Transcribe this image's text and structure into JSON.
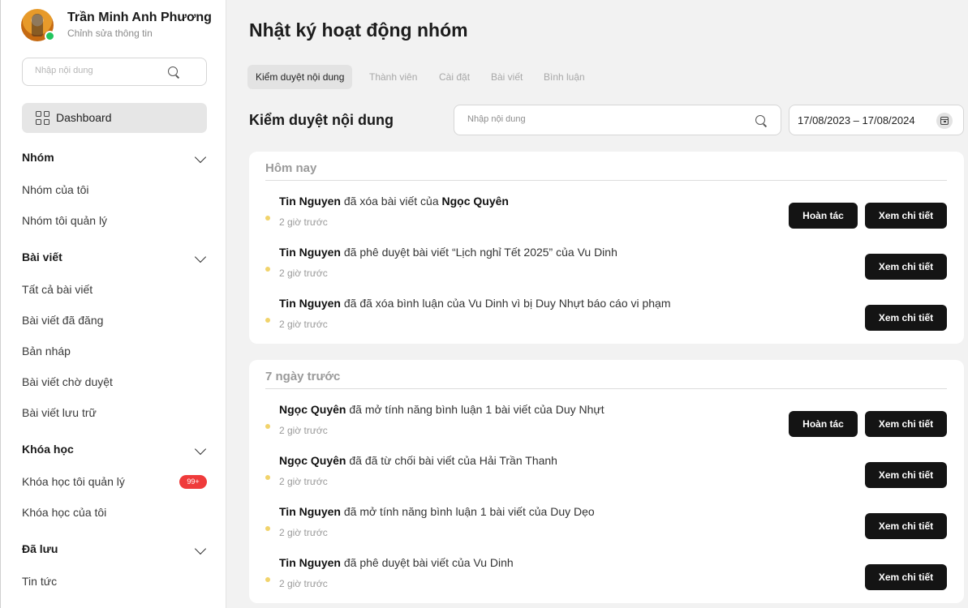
{
  "sidebar": {
    "profile": {
      "name": "Trần Minh Anh Phương",
      "edit_label": "Chỉnh sửa thông tin"
    },
    "search_placeholder": "Nhập nội dung",
    "dashboard_label": "Dashboard",
    "sections": [
      {
        "title": "Nhóm",
        "items": [
          {
            "label": "Nhóm của tôi"
          },
          {
            "label": "Nhóm tôi quản lý"
          }
        ]
      },
      {
        "title": "Bài viết",
        "items": [
          {
            "label": "Tất cả bài viết"
          },
          {
            "label": "Bài viết đã đăng"
          },
          {
            "label": "Bản nháp"
          },
          {
            "label": "Bài viết chờ duyệt"
          },
          {
            "label": "Bài viết lưu trữ"
          }
        ]
      },
      {
        "title": "Khóa học",
        "items": [
          {
            "label": "Khóa học tôi quản lý",
            "badge": "99+"
          },
          {
            "label": "Khóa học của tôi"
          }
        ]
      },
      {
        "title": "Đã lưu",
        "items": [
          {
            "label": "Tin tức"
          }
        ]
      }
    ]
  },
  "main": {
    "title": "Nhật ký hoạt động nhóm",
    "tabs": [
      {
        "label": "Kiểm duyệt nội dung"
      },
      {
        "label": "Thành viên"
      },
      {
        "label": "Cài đặt"
      },
      {
        "label": "Bài viết"
      },
      {
        "label": "Bình luận"
      }
    ],
    "section_title": "Kiểm duyệt nội dung",
    "search_placeholder": "Nhập nội dung",
    "date_range": "17/08/2023  –  17/08/2024",
    "undo_label": "Hoàn tác",
    "detail_label": "Xem chi tiết",
    "groups": [
      {
        "heading": "Hôm nay",
        "rows": [
          {
            "actor": "Tin Nguyen",
            "text": " đã xóa bài viết của ",
            "target": "Ngọc Quyên",
            "time": "2 giờ trước"
          },
          {
            "actor": "Tin Nguyen",
            "text": " đã phê duyệt bài viết “Lịch nghỉ Tết 2025” của Vu Dinh",
            "target": "",
            "time": "2 giờ trước"
          },
          {
            "actor": "Tin Nguyen",
            "text": " đã đã xóa bình luận của Vu Dinh vì bị Duy Nhựt báo cáo vi phạm",
            "target": "",
            "time": "2 giờ trước"
          }
        ]
      },
      {
        "heading": "7 ngày trước",
        "rows": [
          {
            "actor": "Ngọc Quyên",
            "text": " đã mở tính năng bình luận 1 bài viết của Duy Nhựt",
            "target": "",
            "time": "2 giờ trước"
          },
          {
            "actor": "Ngọc Quyên",
            "text": " đã đã từ chối bài viết của Hải Trần Thanh",
            "target": "",
            "time": "2 giờ trước"
          },
          {
            "actor": "Tin Nguyen",
            "text": " đã mở tính năng bình luận 1 bài viết của Duy Dẹo",
            "target": "",
            "time": "2 giờ trước"
          },
          {
            "actor": "Tin Nguyen",
            "text": " đã phê duyệt bài viết của Vu Dinh",
            "target": "",
            "time": "2 giờ trước"
          }
        ]
      }
    ]
  }
}
